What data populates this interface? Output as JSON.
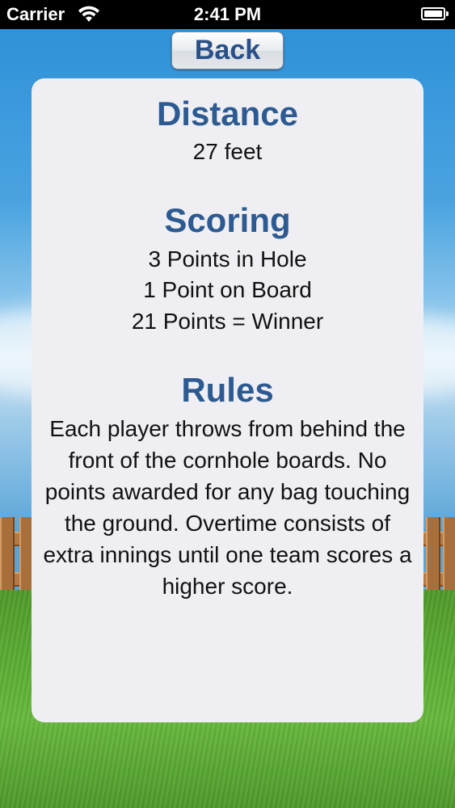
{
  "status_bar": {
    "carrier": "Carrier",
    "time": "2:41 PM",
    "wifi_icon": "wifi-icon",
    "battery_icon": "battery-icon"
  },
  "nav": {
    "back_label": "Back"
  },
  "distance": {
    "title": "Distance",
    "value": "27 feet"
  },
  "scoring": {
    "title": "Scoring",
    "lines": [
      "3 Points in Hole",
      "1 Point on Board",
      "21 Points = Winner"
    ]
  },
  "rules": {
    "title": "Rules",
    "text": "Each player throws from behind the front of the cornhole boards. No points awarded for any bag touching the ground. Overtime consists of extra innings until one team scores a higher score."
  },
  "colors": {
    "title_blue": "#2c5a91",
    "card_bg": "#efeff3",
    "sky": "#4aa3e0",
    "grass": "#5aab33"
  }
}
